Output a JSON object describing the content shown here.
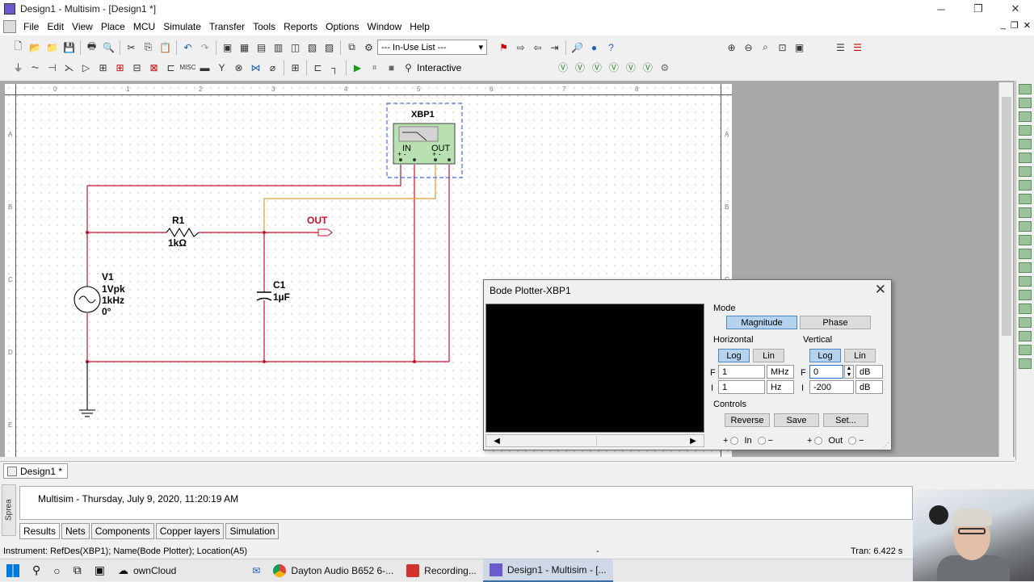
{
  "window": {
    "title": "Design1 - Multisim - [Design1 *]",
    "btn_min": "─",
    "btn_restore": "❐",
    "btn_close": "✕"
  },
  "menu": [
    "File",
    "Edit",
    "View",
    "Place",
    "MCU",
    "Simulate",
    "Transfer",
    "Tools",
    "Reports",
    "Options",
    "Window",
    "Help"
  ],
  "menu_right": {
    "min": "_",
    "restore": "❐",
    "close": "✕"
  },
  "toolbar": {
    "inuse_list": "--- In-Use List ---",
    "interactive": "Interactive"
  },
  "schematic": {
    "ruler_top": [
      "0",
      "1",
      "2",
      "3",
      "4",
      "5",
      "6",
      "7",
      "8"
    ],
    "ruler_left": [
      "A",
      "B",
      "C",
      "D",
      "E"
    ],
    "xbp1": {
      "name": "XBP1",
      "in": "IN",
      "out": "OUT",
      "in_pins": "+ -",
      "out_pins": "+ -"
    },
    "r1": {
      "name": "R1",
      "value": "1kΩ"
    },
    "c1": {
      "name": "C1",
      "value": "1µF"
    },
    "v1": {
      "name": "V1",
      "amp": "1Vpk",
      "freq": "1kHz",
      "phase": "0°"
    },
    "out_label": "OUT"
  },
  "bode": {
    "title": "Bode Plotter-XBP1",
    "close": "✕",
    "mode_label": "Mode",
    "magnitude": "Magnitude",
    "phase": "Phase",
    "horizontal_label": "Horizontal",
    "vertical_label": "Vertical",
    "log": "Log",
    "lin": "Lin",
    "h_f_label": "F",
    "h_i_label": "I",
    "h_f_value": "1",
    "h_f_unit": "MHz",
    "h_i_value": "1",
    "h_i_unit": "Hz",
    "v_f_label": "F",
    "v_i_label": "I",
    "v_f_value": "0",
    "v_f_unit": "dB",
    "v_i_value": "-200",
    "v_i_unit": "dB",
    "controls_label": "Controls",
    "reverse": "Reverse",
    "save": "Save",
    "set": "Set...",
    "in": "In",
    "out": "Out",
    "plus": "+",
    "minus": "−"
  },
  "tabs": {
    "design": "Design1 *"
  },
  "spreadsheet": {
    "side_label": "Sprea",
    "log_text": "Multisim  -  Thursday, July 9, 2020, 11:20:19 AM",
    "tabs": [
      "Results",
      "Nets",
      "Components",
      "Copper layers",
      "Simulation"
    ]
  },
  "status": {
    "instrument": "Instrument: RefDes(XBP1); Name(Bode Plotter); Location(A5)",
    "dash": "-",
    "tran": "Tran: 6.422 s"
  },
  "taskbar": [
    {
      "label": "ownCloud"
    },
    {
      "label": ""
    },
    {
      "label": "Dayton Audio B652 6-..."
    },
    {
      "label": "Recording..."
    },
    {
      "label": "Design1 - Multisim - [..."
    }
  ],
  "colors": {
    "wire_red": "#c8102e",
    "wire_orange": "#e09a30",
    "instrument_green": "#b9e0b0",
    "scope_bg": "#000000",
    "active_btn": "#b5d3ee"
  }
}
